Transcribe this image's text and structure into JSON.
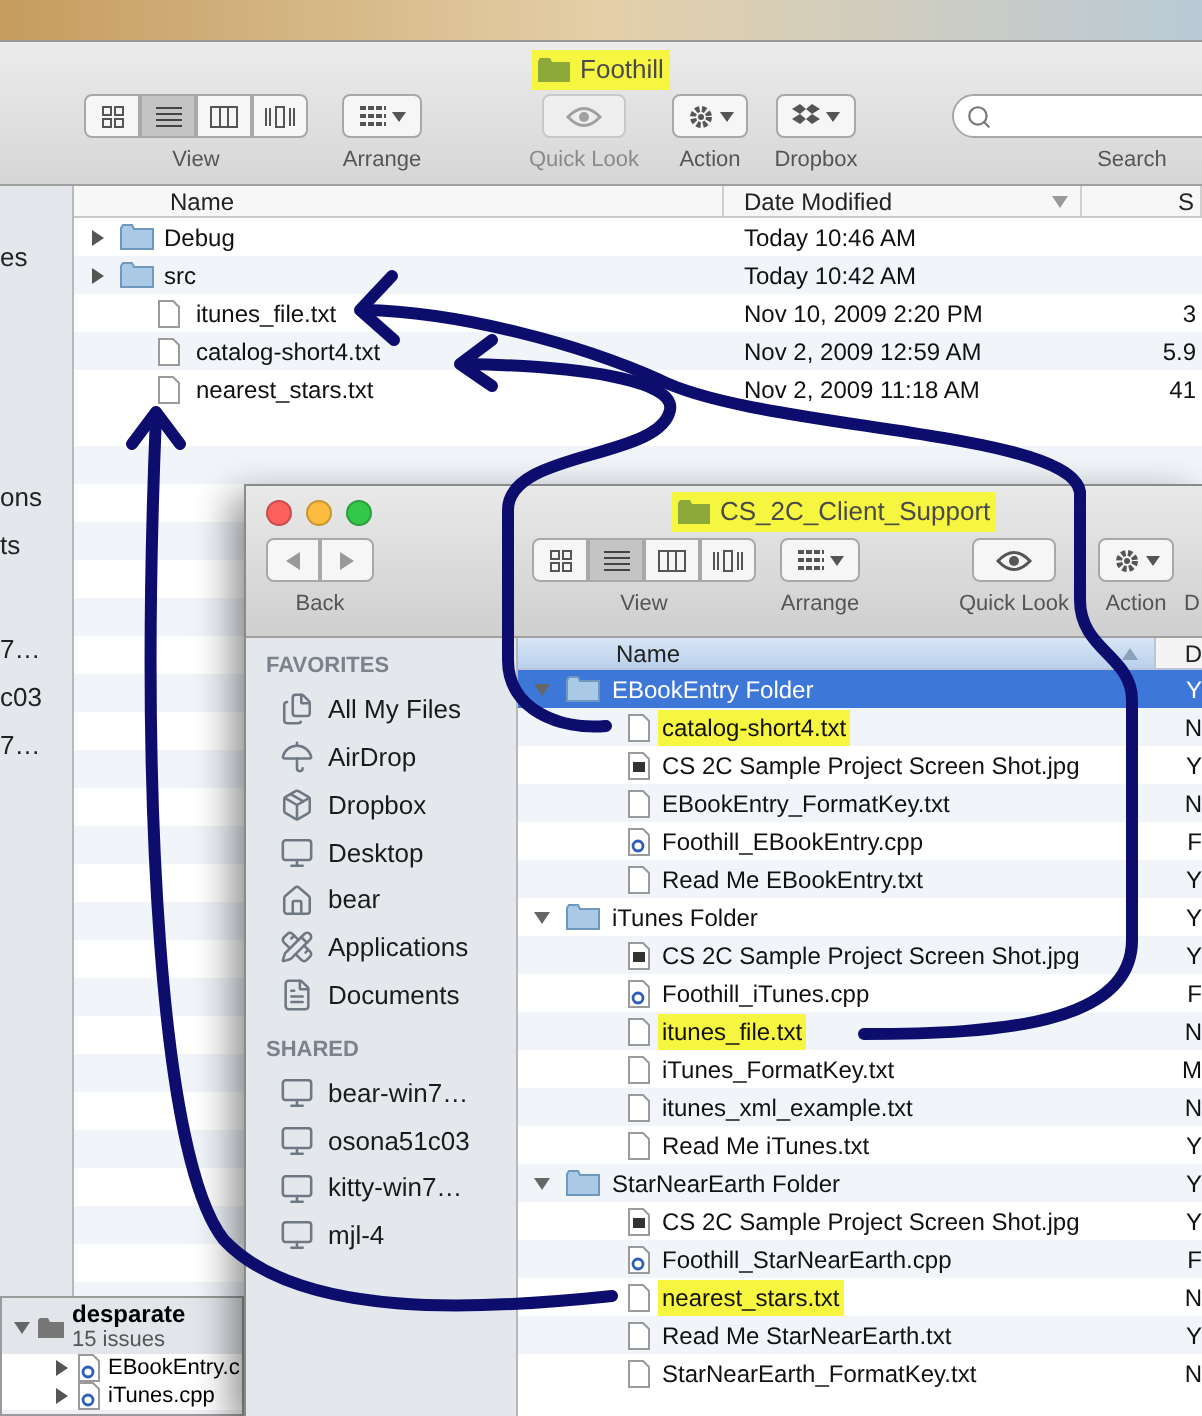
{
  "back_window": {
    "title": "Foothill",
    "title_highlighted": true,
    "view_modes": [
      {
        "kind": "icons",
        "selected": false
      },
      {
        "kind": "list",
        "selected": true
      },
      {
        "kind": "columns",
        "selected": false
      },
      {
        "kind": "coverflow",
        "selected": false
      }
    ],
    "toolbar": [
      {
        "kind": "arrange",
        "label": "Arrange",
        "disabled": false
      },
      {
        "kind": "quicklook",
        "label": "Quick Look",
        "disabled": true
      },
      {
        "kind": "action",
        "label": "Action",
        "disabled": false
      },
      {
        "kind": "dropbox",
        "label": "Dropbox",
        "disabled": false
      }
    ],
    "view_label": "View",
    "search_label": "Search",
    "sidebar": [
      "es",
      "ons",
      "ts",
      "7…",
      "c03",
      "7…"
    ],
    "columns": [
      {
        "label": "Name",
        "sorted": false
      },
      {
        "label": "Date Modified",
        "sorted": true
      },
      {
        "label": "S",
        "sorted": false
      }
    ],
    "rows": [
      {
        "kind": "folder",
        "name": "Debug",
        "date": "Today 10:46 AM"
      },
      {
        "kind": "folder",
        "name": "src",
        "date": "Today 10:42 AM"
      },
      {
        "kind": "text",
        "name": "itunes_file.txt",
        "date": "Nov 10, 2009 2:20 PM",
        "size": "3"
      },
      {
        "kind": "text",
        "name": "catalog-short4.txt",
        "date": "Nov 2, 2009 12:59 AM",
        "size": "5.9"
      },
      {
        "kind": "text",
        "name": "nearest_stars.txt",
        "date": "Nov 2, 2009 11:18 AM",
        "size": "41"
      }
    ]
  },
  "issues_window": {
    "project": "desparate",
    "issues": "15 issues",
    "files": [
      "EBookEntry.c",
      "iTunes.cpp"
    ]
  },
  "front_window": {
    "title": "CS_2C_Client_Support",
    "title_highlighted": true,
    "back_label": "Back",
    "view_modes": [
      {
        "kind": "icons",
        "selected": false
      },
      {
        "kind": "list",
        "selected": true
      },
      {
        "kind": "columns",
        "selected": false
      },
      {
        "kind": "coverflow",
        "selected": false
      }
    ],
    "view_label": "View",
    "toolbar": [
      {
        "kind": "arrange",
        "label": "Arrange",
        "disabled": false
      },
      {
        "kind": "quicklook",
        "label": "Quick Look",
        "disabled": false
      },
      {
        "kind": "action",
        "label": "Action",
        "disabled": false
      },
      {
        "kind": "cut",
        "label": "D"
      }
    ],
    "sidebar": [
      {
        "heading": "FAVORITES",
        "items": [
          {
            "kind": "files",
            "label": "All My Files"
          },
          {
            "kind": "airdrop",
            "label": "AirDrop"
          },
          {
            "kind": "dropbox",
            "label": "Dropbox"
          },
          {
            "kind": "desktop",
            "label": "Desktop"
          },
          {
            "kind": "home",
            "label": "bear"
          },
          {
            "kind": "apps",
            "label": "Applications"
          },
          {
            "kind": "documents",
            "label": "Documents"
          }
        ]
      },
      {
        "heading": "SHARED",
        "items": [
          {
            "kind": "computer",
            "label": "bear-win7…"
          },
          {
            "kind": "computer",
            "label": "osona51c03"
          },
          {
            "kind": "computer",
            "label": "kitty-win7…"
          },
          {
            "kind": "computer",
            "label": "mjl-4"
          }
        ]
      }
    ],
    "columns": [
      {
        "label": "Name",
        "sorted": true
      },
      {
        "label": "D",
        "sorted": false
      }
    ],
    "rows": [
      {
        "kind": "folder",
        "name": "EBookEntry Folder",
        "column_2": "Y",
        "expanded": true,
        "selected": true,
        "highlighted": false,
        "children": [
          {
            "kind": "text",
            "name": "catalog-short4.txt",
            "column_2": "N",
            "selected": false,
            "highlighted": true
          },
          {
            "kind": "image",
            "name": "CS 2C Sample Project Screen Shot.jpg",
            "column_2": "Y",
            "selected": false,
            "highlighted": false
          },
          {
            "kind": "text",
            "name": "EBookEntry_FormatKey.txt",
            "column_2": "N",
            "selected": false,
            "highlighted": false
          },
          {
            "kind": "cpp",
            "name": "Foothill_EBookEntry.cpp",
            "column_2": "F",
            "selected": false,
            "highlighted": false
          },
          {
            "kind": "text",
            "name": "Read Me EBookEntry.txt",
            "column_2": "Y",
            "selected": false,
            "highlighted": false
          }
        ]
      },
      {
        "kind": "folder",
        "name": "iTunes Folder",
        "column_2": "Y",
        "expanded": true,
        "selected": false,
        "highlighted": false,
        "children": [
          {
            "kind": "image",
            "name": "CS 2C Sample Project Screen Shot.jpg",
            "column_2": "Y",
            "selected": false,
            "highlighted": false
          },
          {
            "kind": "cpp",
            "name": "Foothill_iTunes.cpp",
            "column_2": "F",
            "selected": false,
            "highlighted": false
          },
          {
            "kind": "text",
            "name": "itunes_file.txt",
            "column_2": "N",
            "selected": false,
            "highlighted": true
          },
          {
            "kind": "text",
            "name": "iTunes_FormatKey.txt",
            "column_2": "M",
            "selected": false,
            "highlighted": false
          },
          {
            "kind": "text",
            "name": "itunes_xml_example.txt",
            "column_2": "N",
            "selected": false,
            "highlighted": false
          },
          {
            "kind": "text",
            "name": "Read Me iTunes.txt",
            "column_2": "Y",
            "selected": false,
            "highlighted": false
          }
        ]
      },
      {
        "kind": "folder",
        "name": "StarNearEarth Folder",
        "column_2": "Y",
        "expanded": true,
        "selected": false,
        "highlighted": false,
        "children": [
          {
            "kind": "image",
            "name": "CS 2C Sample Project Screen Shot.jpg",
            "column_2": "Y",
            "selected": false,
            "highlighted": false
          },
          {
            "kind": "cpp",
            "name": "Foothill_StarNearEarth.cpp",
            "column_2": "F",
            "selected": false,
            "highlighted": false
          },
          {
            "kind": "text",
            "name": "nearest_stars.txt",
            "column_2": "N",
            "selected": false,
            "highlighted": true
          },
          {
            "kind": "text",
            "name": "Read Me StarNearEarth.txt",
            "column_2": "Y",
            "selected": false,
            "highlighted": false
          },
          {
            "kind": "text",
            "name": "StarNearEarth_FormatKey.txt",
            "column_2": "N",
            "selected": false,
            "highlighted": false
          }
        ]
      }
    ]
  }
}
